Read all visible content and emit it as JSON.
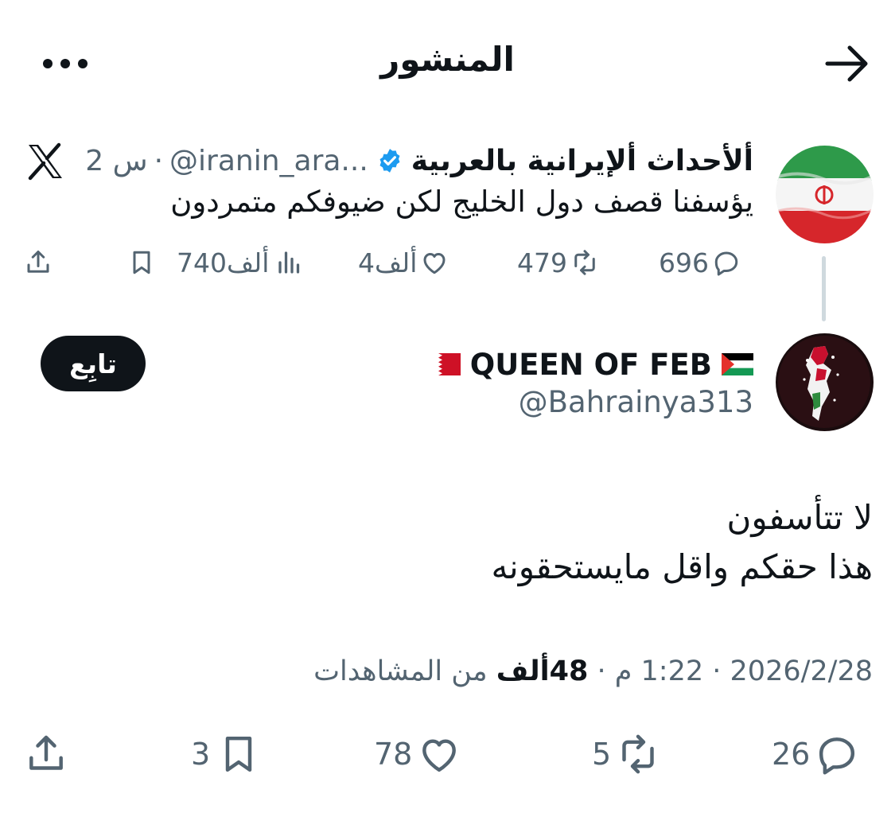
{
  "header": {
    "title": "المنشور",
    "back_icon": "arrow-right-icon",
    "more_icon": "more-horizontal-icon"
  },
  "parent_tweet": {
    "author_name": "ألأحداث ألإيرانية بالعربية",
    "verified_icon": "verified-badge-icon",
    "handle": "@iranin_ara...",
    "separator": "·",
    "time": "2 س",
    "text": "يؤسفنا قصف دول الخليج لكن ضيوفكم متمردون",
    "replies": "696",
    "reposts": "479",
    "likes": "4ألف",
    "views": "740ألف"
  },
  "main_tweet": {
    "author_name": "QUEEN OF FEB",
    "handle": "@Bahrainya313",
    "follow_label": "تابِع",
    "text_lines": [
      "لا تتأسفون",
      "هذا حقكم واقل مايستحقونه"
    ],
    "date": "2026/2/28",
    "time": "1:22 م",
    "views_count": "48ألف",
    "views_label": "من المشاهدات",
    "replies": "26",
    "reposts": "5",
    "likes": "78",
    "bookmarks": "3"
  },
  "colors": {
    "text_primary": "#0f1419",
    "text_secondary": "#536471",
    "verified_blue": "#1d9bf0",
    "thread_line": "#cfd9de"
  }
}
